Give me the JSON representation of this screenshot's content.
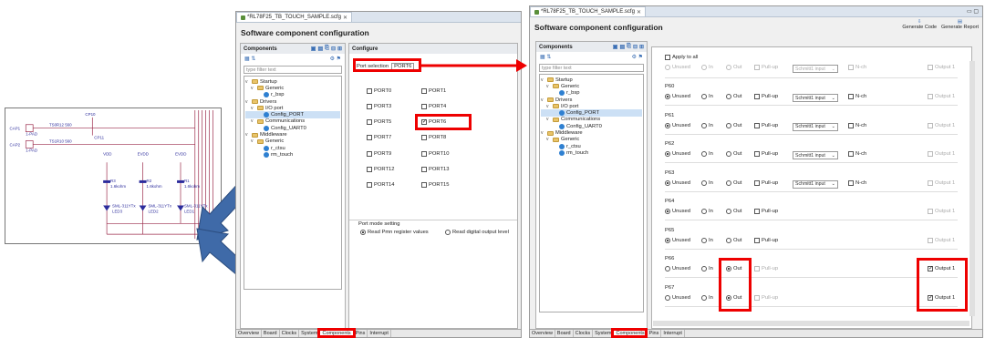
{
  "schematic": {
    "labels": [
      "CAP1",
      "CAP2",
      "TS0",
      "TS1",
      "R12 560",
      "R10 560",
      "CP10",
      "CP11",
      "VDD",
      "EVDD",
      "EVDD",
      "R3",
      "1.6kohm",
      "R2",
      "1.6kohm",
      "R1",
      "1.6kohm",
      "SML-311YTx",
      "LED3",
      "SML-311YTx",
      "LED2",
      "SML-311YTx",
      "LED1",
      "1-PAD",
      "1-PAD"
    ]
  },
  "left_window": {
    "tab": "*RL78F25_TB_TOUCH_SAMPLE.scfg",
    "title": "Software component configuration",
    "components_header": "Components",
    "configure_header": "Configure",
    "filter_placeholder": "type filter text",
    "tree": [
      "Startup",
      "Generic",
      "r_bsp",
      "Drivers",
      "I/O port",
      "Config_PORT",
      "Communications",
      "Config_UART0",
      "Middleware",
      "Generic",
      "r_ctsu",
      "rm_touch"
    ],
    "port_selection_label": "Port selection",
    "port_selection_tab": "PORT6",
    "ports": [
      {
        "name": "PORT0",
        "checked": false
      },
      {
        "name": "PORT1",
        "checked": false
      },
      {
        "name": "PORT3",
        "checked": false
      },
      {
        "name": "PORT4",
        "checked": false
      },
      {
        "name": "PORT5",
        "checked": false
      },
      {
        "name": "PORT6",
        "checked": true
      },
      {
        "name": "PORT7",
        "checked": false
      },
      {
        "name": "PORT8",
        "checked": false
      },
      {
        "name": "PORT9",
        "checked": false
      },
      {
        "name": "PORT10",
        "checked": false
      },
      {
        "name": "PORT12",
        "checked": false
      },
      {
        "name": "PORT13",
        "checked": false
      },
      {
        "name": "PORT14",
        "checked": false
      },
      {
        "name": "PORT15",
        "checked": false
      }
    ],
    "port_mode_setting": "Port mode setting",
    "read_pmn": "Read Pmn register values",
    "read_digital": "Read digital output level",
    "bottom_tabs": [
      "Overview",
      "Board",
      "Clocks",
      "System",
      "Components",
      "Pins",
      "Interrupt"
    ]
  },
  "right_window": {
    "tab": "*RL78F25_TB_TOUCH_SAMPLE.scfg",
    "title": "Software component configuration",
    "generate_code": "Generate Code",
    "generate_report": "Generate Report",
    "components_header": "Components",
    "filter_placeholder": "type filter text",
    "tree": [
      "Startup",
      "Generic",
      "r_bsp",
      "Drivers",
      "I/O port",
      "Config_PORT",
      "Communications",
      "Config_UART0",
      "Middleware",
      "Generic",
      "r_ctsu",
      "rm_touch"
    ],
    "apply_to_all": "Apply to all",
    "opt_unused": "Unused",
    "opt_in": "In",
    "opt_out": "Out",
    "opt_pullup": "Pull-up",
    "opt_nch": "N-ch",
    "opt_output1": "Output 1",
    "schmitt": "Schmitt1 input",
    "pins": [
      {
        "name": "P60",
        "sel": "unused",
        "schmitt": true
      },
      {
        "name": "P61",
        "sel": "unused",
        "schmitt": true
      },
      {
        "name": "P62",
        "sel": "unused",
        "schmitt": true
      },
      {
        "name": "P63",
        "sel": "unused",
        "schmitt": true
      },
      {
        "name": "P64",
        "sel": "unused",
        "schmitt": false
      },
      {
        "name": "P65",
        "sel": "unused",
        "schmitt": false
      },
      {
        "name": "P66",
        "sel": "out",
        "schmitt": false
      },
      {
        "name": "P67",
        "sel": "out",
        "schmitt": false
      }
    ],
    "bottom_tabs": [
      "Overview",
      "Board",
      "Clocks",
      "System",
      "Components",
      "Pins",
      "Interrupt"
    ]
  },
  "colors": {
    "highlight": "#e00000",
    "arrow": "#3f6aa8"
  }
}
